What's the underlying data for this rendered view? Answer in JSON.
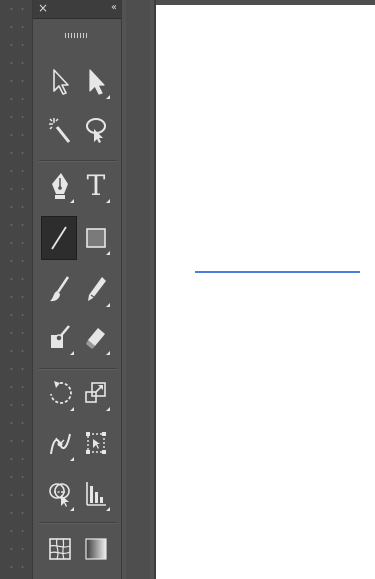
{
  "panel": {
    "close_glyph": "×",
    "collapse_glyph": "‹‹"
  },
  "tools": [
    {
      "name": "selection-tool",
      "icon": "arrow-pointer-icon",
      "active": false
    },
    {
      "name": "direct-selection-tool",
      "icon": "white-arrow-pointer-icon",
      "active": false
    },
    {
      "name": "magic-wand-tool",
      "icon": "magic-wand-icon",
      "active": false
    },
    {
      "name": "lasso-tool",
      "icon": "lasso-icon",
      "active": false
    },
    {
      "name": "pen-tool",
      "icon": "pen-nib-icon",
      "active": false
    },
    {
      "name": "type-tool",
      "icon": "type-icon",
      "label": "T",
      "active": false
    },
    {
      "name": "line-segment-tool",
      "icon": "line-segment-icon",
      "active": true
    },
    {
      "name": "rectangle-tool",
      "icon": "rectangle-icon",
      "active": false
    },
    {
      "name": "paintbrush-tool",
      "icon": "paintbrush-icon",
      "active": false
    },
    {
      "name": "pencil-tool",
      "icon": "pencil-icon",
      "active": false
    },
    {
      "name": "shape-builder-tool",
      "icon": "brush-bucket-icon",
      "active": false
    },
    {
      "name": "eraser-tool",
      "icon": "eraser-icon",
      "active": false
    },
    {
      "name": "rotate-tool",
      "icon": "rotate-icon",
      "active": false
    },
    {
      "name": "scale-tool",
      "icon": "scale-icon",
      "active": false
    },
    {
      "name": "width-tool",
      "icon": "width-tool-icon",
      "active": false
    },
    {
      "name": "free-transform-tool",
      "icon": "free-transform-icon",
      "active": false
    },
    {
      "name": "shape-builder-2-tool",
      "icon": "shape-builder-icon",
      "active": false
    },
    {
      "name": "graph-tool",
      "icon": "column-graph-icon",
      "active": false
    },
    {
      "name": "mesh-tool",
      "icon": "mesh-icon",
      "active": false
    },
    {
      "name": "gradient-tool",
      "icon": "gradient-icon",
      "active": false
    }
  ],
  "colors": {
    "panel_bg": "#535353",
    "active_tool_bg": "#2d2d2d",
    "canvas_bg": "#ffffff",
    "drawn_line": "#4e7ddf",
    "icon": "#e6e6e6"
  }
}
